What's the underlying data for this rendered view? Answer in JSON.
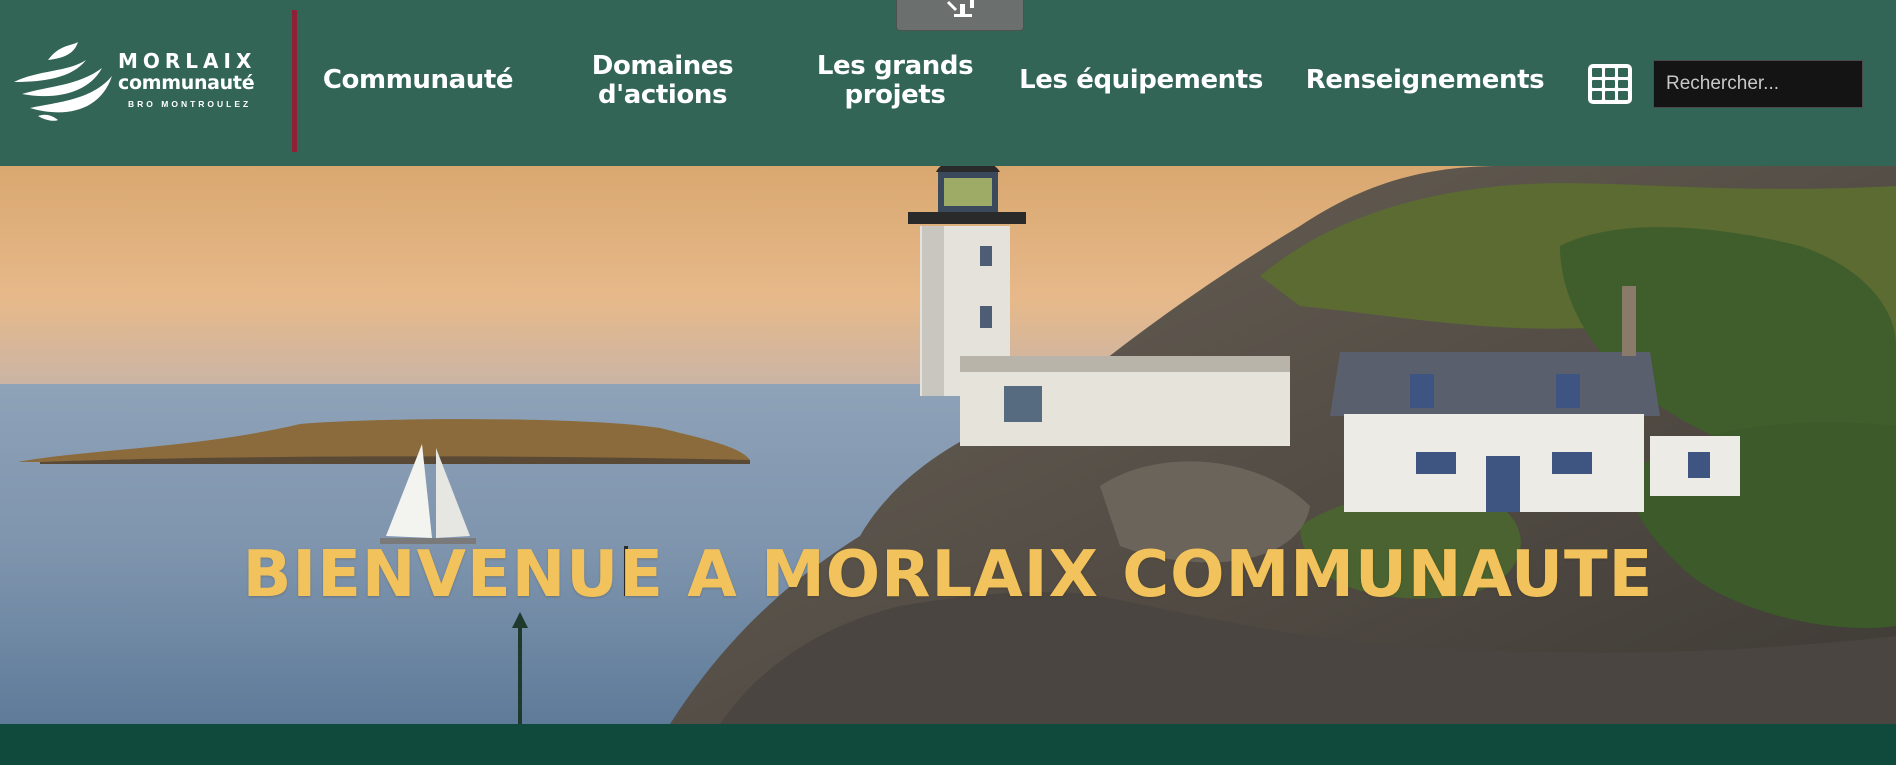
{
  "header": {
    "logo": {
      "line1": "MORLAIX",
      "line2": "communauté",
      "line3": "BRO MONTROULEZ"
    },
    "nav": [
      {
        "label": "Communauté"
      },
      {
        "label_line1": "Domaines",
        "label_line2": "d'actions"
      },
      {
        "label_line1": "Les grands",
        "label_line2": "projets"
      },
      {
        "label": "Les équipements"
      },
      {
        "label": "Renseignements"
      }
    ],
    "apps_icon": "grid-icon",
    "search": {
      "placeholder": "Rechercher...",
      "value": ""
    }
  },
  "hero": {
    "title": "BIENVENUE A MORLAIX COMMUNAUTE",
    "image": "lighthouse-coast-photo"
  },
  "colors": {
    "header_bg": "#336556",
    "accent_divider": "#8e2038",
    "hero_title": "#f2c35c",
    "footer_band": "#0f4a3c"
  }
}
